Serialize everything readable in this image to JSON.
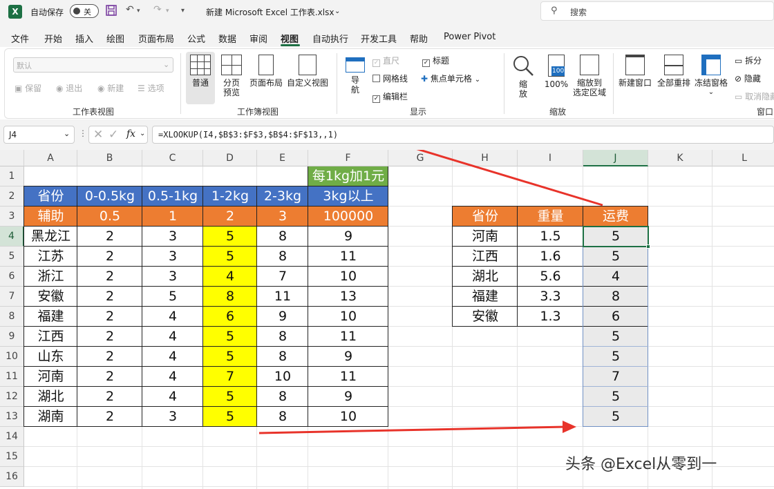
{
  "titlebar": {
    "logo": "X",
    "autosave_label": "自动保存",
    "autosave_state": "关",
    "filename": "新建 Microsoft Excel 工作表.xlsx",
    "search_placeholder": "搜索",
    "icons": [
      "save-icon",
      "undo-icon",
      "redo-icon",
      "customize-icon",
      "search-icon"
    ]
  },
  "menu": [
    "文件",
    "开始",
    "插入",
    "绘图",
    "页面布局",
    "公式",
    "数据",
    "审阅",
    "视图",
    "自动执行",
    "开发工具",
    "帮助",
    "Power Pivot"
  ],
  "active_menu": "视图",
  "ribbon": {
    "sheetview": {
      "combo": "默认",
      "buttons": [
        "保留",
        "退出",
        "新建",
        "选项"
      ],
      "label": "工作表视图"
    },
    "workbookview": {
      "buttons": [
        "普通",
        "分页\n预览",
        "页面布局",
        "自定义视图"
      ],
      "label": "工作簿视图"
    },
    "show": {
      "nav": "导\n航",
      "ruler": "直尺",
      "title": "标题",
      "gridlines": "网格线",
      "focus": "焦点单元格",
      "editbar": "编辑栏",
      "label": "显示"
    },
    "zoom": {
      "buttons": [
        "缩\n放",
        "100%",
        "缩放到\n选定区域"
      ],
      "badge": "100",
      "label": "缩放"
    },
    "window": {
      "buttons": [
        "新建窗口",
        "全部重排",
        "冻结窗格"
      ],
      "split": "拆分",
      "hide": "隐藏",
      "unhide": "取消隐藏",
      "label": "窗口"
    }
  },
  "formula_bar": {
    "cell_ref": "J4",
    "fx": "fx",
    "formula": "=XLOOKUP(I4,$B$3:$F$3,$B$4:$F$13,,1)"
  },
  "columns": [
    "A",
    "B",
    "C",
    "D",
    "E",
    "F",
    "G",
    "H",
    "I",
    "J",
    "K",
    "L"
  ],
  "rows": [
    "1",
    "2",
    "3",
    "4",
    "5",
    "6",
    "7",
    "8",
    "9",
    "10",
    "11",
    "12",
    "13",
    "14",
    "15",
    "16"
  ],
  "selected_cell": "J4",
  "colors": {
    "blue_header": "#4472c4",
    "orange_header": "#ed7d31",
    "green_note": "#70ad47",
    "yellow": "#ffff00",
    "selection": "#1d7044",
    "arrow": "#e8332a"
  },
  "table1": {
    "note": "每1kg加1元",
    "header": [
      "省份",
      "0-0.5kg",
      "0.5-1kg",
      "1-2kg",
      "2-3kg",
      "3kg以上"
    ],
    "helper": [
      "辅助",
      "0.5",
      "1",
      "2",
      "3",
      "100000"
    ],
    "rows": [
      [
        "黑龙江",
        "2",
        "3",
        "5",
        "8",
        "9"
      ],
      [
        "江苏",
        "2",
        "3",
        "5",
        "8",
        "11"
      ],
      [
        "浙江",
        "2",
        "3",
        "4",
        "7",
        "10"
      ],
      [
        "安徽",
        "2",
        "5",
        "8",
        "11",
        "13"
      ],
      [
        "福建",
        "2",
        "4",
        "6",
        "9",
        "10"
      ],
      [
        "江西",
        "2",
        "4",
        "5",
        "8",
        "11"
      ],
      [
        "山东",
        "2",
        "4",
        "5",
        "8",
        "9"
      ],
      [
        "河南",
        "2",
        "4",
        "7",
        "10",
        "11"
      ],
      [
        "湖北",
        "2",
        "4",
        "5",
        "8",
        "9"
      ],
      [
        "湖南",
        "2",
        "3",
        "5",
        "8",
        "10"
      ]
    ]
  },
  "table2": {
    "header": [
      "省份",
      "重量",
      "运费"
    ],
    "rows": [
      [
        "河南",
        "1.5",
        "5"
      ],
      [
        "江西",
        "1.6",
        "5"
      ],
      [
        "湖北",
        "5.6",
        "4"
      ],
      [
        "福建",
        "3.3",
        "8"
      ],
      [
        "安徽",
        "1.3",
        "6"
      ]
    ],
    "extra_j": [
      "5",
      "5",
      "7",
      "5",
      "5"
    ]
  },
  "watermark": "头条 @Excel从零到一"
}
